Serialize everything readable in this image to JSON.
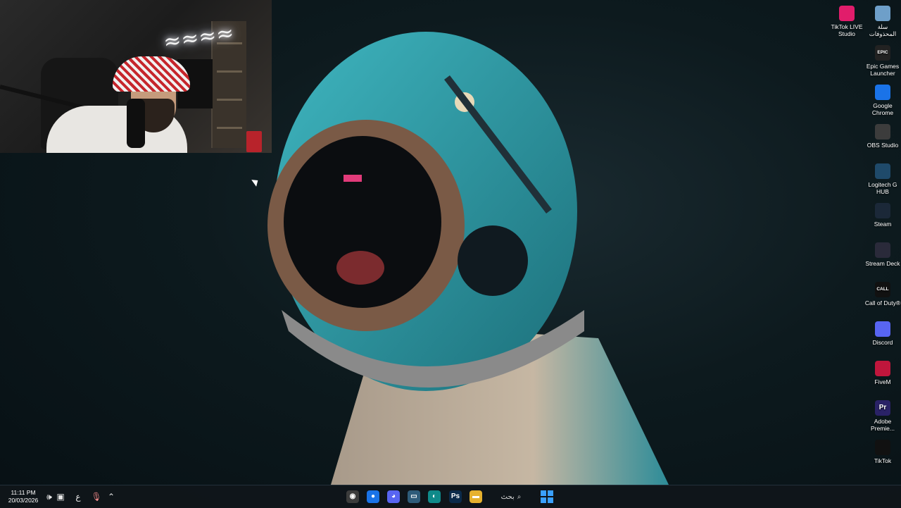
{
  "desktop_icons": [
    {
      "label": "سلة المحذوفات",
      "icon": "recycle-bin-icon",
      "color": "#6e9fc9"
    },
    {
      "label": "TikTok LIVE Studio",
      "icon": "tiktok-live-studio-icon",
      "color": "#e11d6b"
    },
    {
      "label": "Epic Games Launcher",
      "icon": "epic-games-icon",
      "color": "#222222",
      "glyph": "EPIC"
    },
    {
      "label": "Google Chrome",
      "icon": "chrome-icon",
      "color": "#1a73e8"
    },
    {
      "label": "OBS Studio",
      "icon": "obs-icon",
      "color": "#3c3c3c"
    },
    {
      "label": "Logitech G HUB",
      "icon": "logitech-g-hub-icon",
      "color": "#1f4a6a"
    },
    {
      "label": "Steam",
      "icon": "steam-icon",
      "color": "#1b2838"
    },
    {
      "label": "Stream Deck",
      "icon": "stream-deck-icon",
      "color": "#2a2a3a"
    },
    {
      "label": "Call of Duty®",
      "icon": "call-of-duty-icon",
      "color": "#111111",
      "glyph": "CALL"
    },
    {
      "label": "Discord",
      "icon": "discord-icon",
      "color": "#5865f2"
    },
    {
      "label": "FiveM",
      "icon": "fivem-icon",
      "color": "#c0163c"
    },
    {
      "label": "Adobe Premie...",
      "icon": "adobe-premiere-icon",
      "color": "#2a2266",
      "glyph": "Pr"
    },
    {
      "label": "TikTok",
      "icon": "tiktok-icon",
      "color": "#111111"
    }
  ],
  "taskbar": {
    "time": "11:11 PM",
    "date": "20/03/2026",
    "keyboard_lang": "ع",
    "search_label": "بحث",
    "apps": [
      {
        "name": "obs-taskbar-icon",
        "color": "#3c3c3c",
        "glyph": "◉"
      },
      {
        "name": "chrome-taskbar-icon",
        "color": "#1a73e8",
        "glyph": "●"
      },
      {
        "name": "discord-taskbar-icon",
        "color": "#5865f2",
        "glyph": "◕"
      },
      {
        "name": "task-view-taskbar-icon",
        "color": "#2e5c7a",
        "glyph": "▭"
      },
      {
        "name": "edge-taskbar-icon",
        "color": "#0f8a8a",
        "glyph": "◐"
      },
      {
        "name": "photoshop-taskbar-icon",
        "color": "#0b2a4a",
        "glyph": "Ps"
      },
      {
        "name": "file-explorer-taskbar-icon",
        "color": "#e6b12e",
        "glyph": "▬"
      }
    ]
  }
}
